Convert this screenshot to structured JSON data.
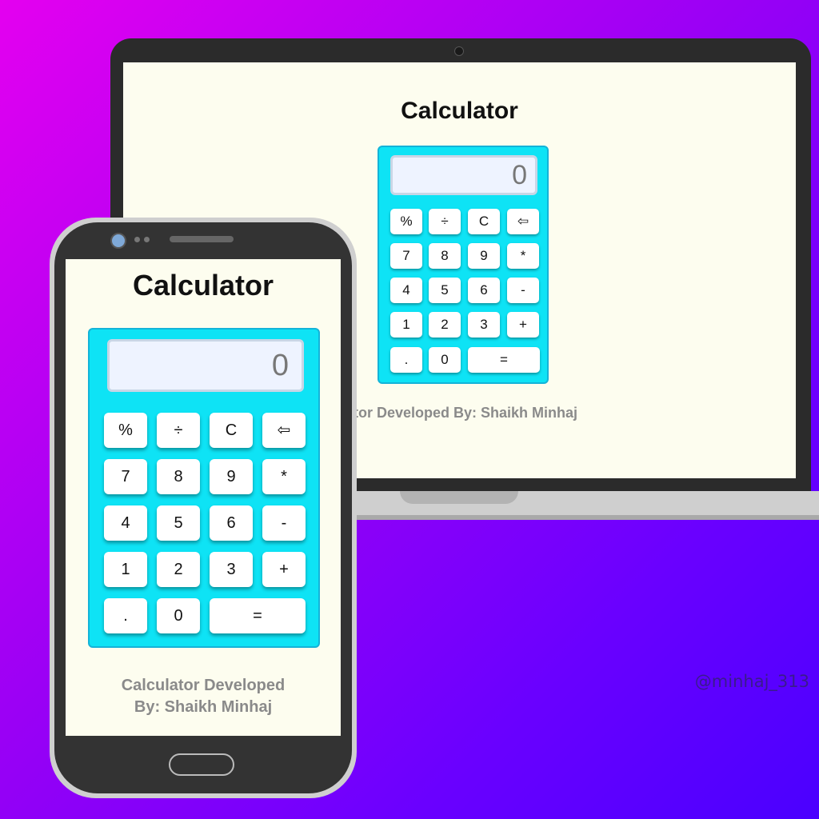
{
  "title": "Calculator",
  "display_value": "0",
  "keys": {
    "percent": "%",
    "divide": "÷",
    "clear": "C",
    "backspace": "⇦",
    "seven": "7",
    "eight": "8",
    "nine": "9",
    "multiply": "*",
    "four": "4",
    "five": "5",
    "six": "6",
    "minus": "-",
    "one": "1",
    "two": "2",
    "three": "3",
    "plus": "+",
    "dot": ".",
    "zero": "0",
    "equals": "="
  },
  "laptop_footer": "lator Developed By: Shaikh Minhaj",
  "phone_footer_line1": "Calculator Developed",
  "phone_footer_line2": "By: Shaikh Minhaj",
  "watermark": "@minhaj_313",
  "colors": {
    "background_start": "#e400f0",
    "background_end": "#4a00ff",
    "calculator_body": "#0ee3f5",
    "screen_bg": "#fdfdef",
    "footer_text": "#8a8a8a"
  }
}
